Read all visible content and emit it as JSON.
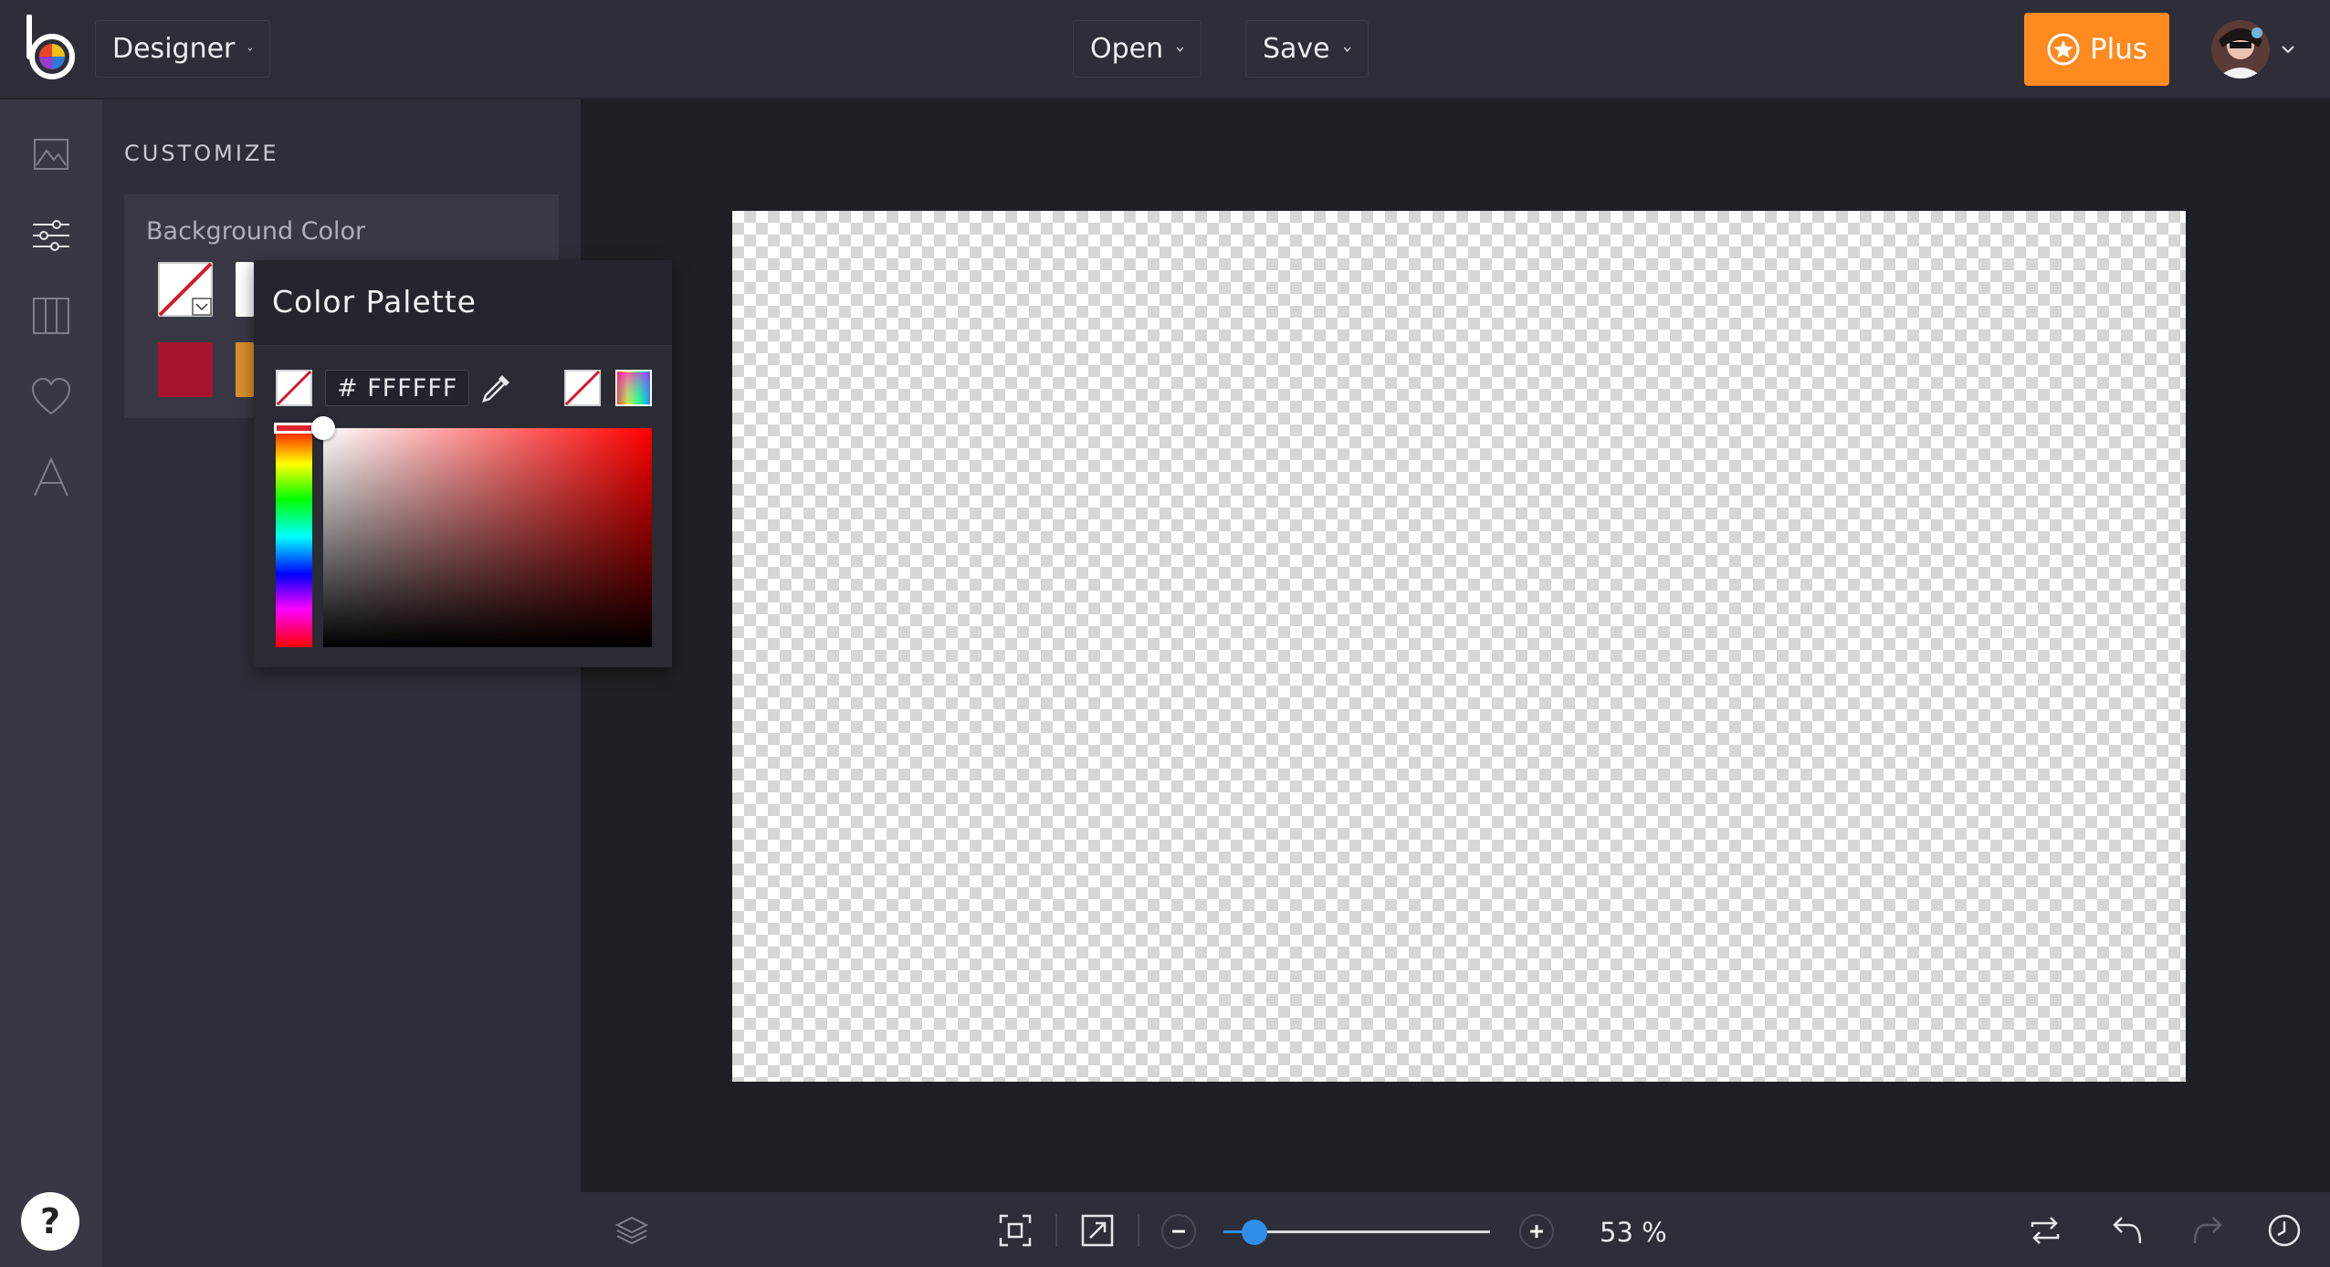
{
  "header": {
    "mode_label": "Designer",
    "open_label": "Open",
    "save_label": "Save",
    "plus_label": "Plus",
    "plus_color": "#ff8a1f"
  },
  "sidebar": {
    "icons": [
      "image-icon",
      "sliders-icon",
      "columns-icon",
      "heart-icon",
      "text-icon"
    ],
    "help_label": "?"
  },
  "panel": {
    "title": "CUSTOMIZE",
    "background_label": "Background Color",
    "swatch_colors": [
      "transparent",
      "#ffffff",
      "#a8132e",
      "#d9902b"
    ]
  },
  "palette": {
    "title": "Color Palette",
    "hex_value": "# FFFFFF",
    "selected_hue": "#e0242f"
  },
  "toolbar": {
    "zoom_percent": "53 %",
    "zoom_level": 0.53
  }
}
